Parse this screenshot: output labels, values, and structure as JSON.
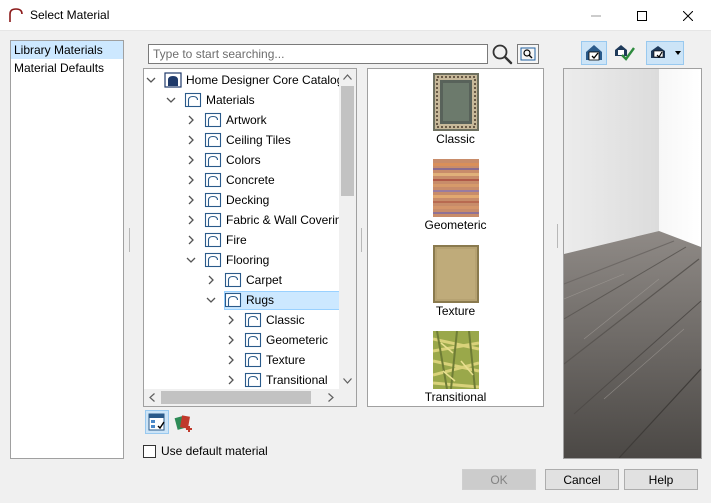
{
  "window": {
    "title": "Select Material"
  },
  "left_panel": {
    "items": [
      "Library Materials",
      "Material Defaults"
    ]
  },
  "search": {
    "placeholder": "Type to start searching..."
  },
  "tree": [
    {
      "label": "Home Designer Core Catalog",
      "level": 0,
      "expanded": true,
      "root": true
    },
    {
      "label": "Materials",
      "level": 1,
      "expanded": true
    },
    {
      "label": "Artwork",
      "level": 2,
      "expanded": false
    },
    {
      "label": "Ceiling Tiles",
      "level": 2,
      "expanded": false
    },
    {
      "label": "Colors",
      "level": 2,
      "expanded": false
    },
    {
      "label": "Concrete",
      "level": 2,
      "expanded": false
    },
    {
      "label": "Decking",
      "level": 2,
      "expanded": false
    },
    {
      "label": "Fabric & Wall Covering",
      "level": 2,
      "expanded": false
    },
    {
      "label": "Fire",
      "level": 2,
      "expanded": false
    },
    {
      "label": "Flooring",
      "level": 2,
      "expanded": true
    },
    {
      "label": "Carpet",
      "level": 3,
      "expanded": false
    },
    {
      "label": "Rugs",
      "level": 3,
      "expanded": true,
      "selected": true
    },
    {
      "label": "Classic",
      "level": 4,
      "expanded": false
    },
    {
      "label": "Geometeric",
      "level": 4,
      "expanded": false
    },
    {
      "label": "Texture",
      "level": 4,
      "expanded": false
    },
    {
      "label": "Transitional",
      "level": 4,
      "expanded": false
    }
  ],
  "preview": [
    {
      "label": "Classic",
      "swatch": "classic"
    },
    {
      "label": "Geometeric",
      "swatch": "geometeric"
    },
    {
      "label": "Texture",
      "swatch": "texture"
    },
    {
      "label": "Transitional",
      "swatch": "transitional"
    }
  ],
  "checkbox": {
    "label": "Use default material",
    "checked": false
  },
  "buttons": {
    "ok": "OK",
    "cancel": "Cancel",
    "help": "Help"
  },
  "colors": {
    "selection": "#cce8ff",
    "selection_border": "#99d1ff",
    "accent": "#0078d7"
  }
}
